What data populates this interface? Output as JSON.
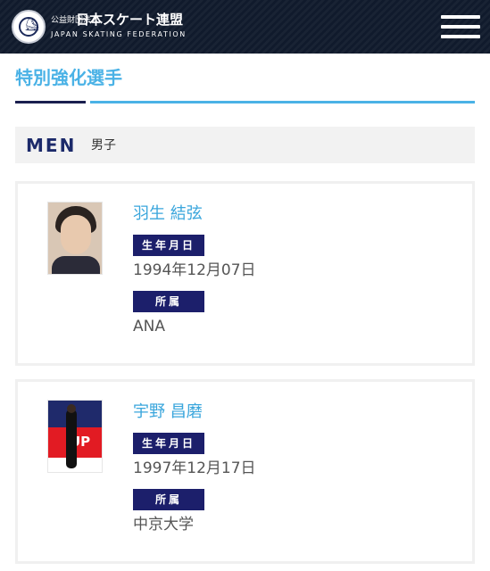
{
  "header": {
    "org_prefix": "公益財団法人",
    "org_name": "日本スケート連盟",
    "org_name_en": "JAPAN SKATING FEDERATION",
    "logo_icon": "jsf-emblem-icon",
    "menu_icon": "hamburger-menu-icon"
  },
  "page": {
    "title": "特別強化選手"
  },
  "section": {
    "label_en": "MEN",
    "label_jp": "男子"
  },
  "colors": {
    "header_bg": "#101a2c",
    "accent_light": "#4ab2e6",
    "accent_dark": "#1c1f6b",
    "section_bg": "#f2f2f2"
  },
  "athletes": [
    {
      "name": "羽生 結弦",
      "birth_label": "生年月日",
      "birth_date": "1994年12月07日",
      "affiliation_label": "所属",
      "affiliation": "ANA"
    },
    {
      "name": "宇野 昌磨",
      "birth_label": "生年月日",
      "birth_date": "1997年12月17日",
      "affiliation_label": "所属",
      "affiliation": "中京大学",
      "photo_banner_text": "UP"
    }
  ]
}
